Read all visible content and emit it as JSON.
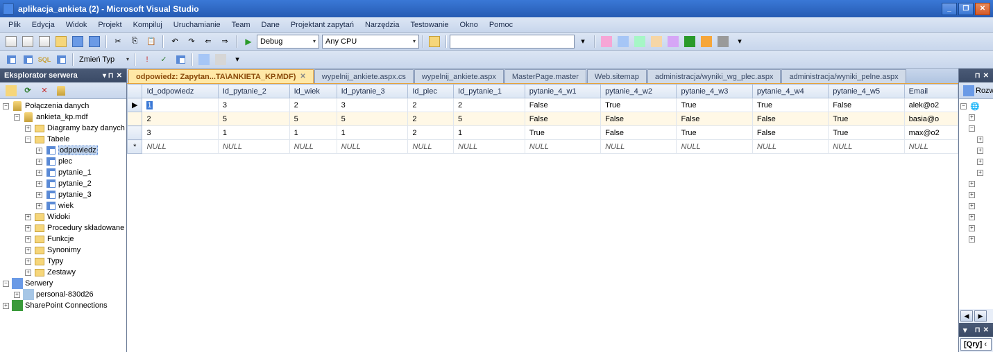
{
  "titlebar": {
    "title": "aplikacja_ankieta (2) - Microsoft Visual Studio"
  },
  "menu": [
    "Plik",
    "Edycja",
    "Widok",
    "Projekt",
    "Kompiluj",
    "Uruchamianie",
    "Team",
    "Dane",
    "Projektant zapytań",
    "Narzędzia",
    "Testowanie",
    "Okno",
    "Pomoc"
  ],
  "toolbar": {
    "config": "Debug",
    "platform": "Any CPU",
    "zmien": "Zmień Typ"
  },
  "explorer": {
    "title": "Eksplorator serwera",
    "tree": {
      "conn": "Połączenia danych",
      "db": "ankieta_kp.mdf",
      "diagrams": "Diagramy bazy danych",
      "tables": "Tabele",
      "tbl_odpowiedz": "odpowiedz",
      "tbl_plec": "plec",
      "tbl_pytanie1": "pytanie_1",
      "tbl_pytanie2": "pytanie_2",
      "tbl_pytanie3": "pytanie_3",
      "tbl_wiek": "wiek",
      "views": "Widoki",
      "procs": "Procedury składowane",
      "funcs": "Funkcje",
      "syns": "Synonimy",
      "types": "Typy",
      "assemblies": "Zestawy",
      "servers": "Serwery",
      "personal": "personal-830d26",
      "sharepoint": "SharePoint Connections"
    }
  },
  "tabs": [
    "odpowiedz: Zapytan...TA\\ANKIETA_KP.MDF)",
    "wypelnij_ankiete.aspx.cs",
    "wypelnij_ankiete.aspx",
    "MasterPage.master",
    "Web.sitemap",
    "administracja/wyniki_wg_plec.aspx",
    "administracja/wyniki_pelne.aspx"
  ],
  "grid": {
    "columns": [
      "Id_odpowiedz",
      "Id_pytanie_2",
      "Id_wiek",
      "Id_pytanie_3",
      "Id_plec",
      "Id_pytanie_1",
      "pytanie_4_w1",
      "pytanie_4_w2",
      "pytanie_4_w3",
      "pytanie_4_w4",
      "pytanie_4_w5",
      "Email"
    ],
    "rows": [
      [
        "1",
        "3",
        "2",
        "3",
        "2",
        "2",
        "False",
        "True",
        "True",
        "True",
        "False",
        "alek@o2"
      ],
      [
        "2",
        "5",
        "5",
        "5",
        "2",
        "5",
        "False",
        "False",
        "False",
        "False",
        "True",
        "basia@o"
      ],
      [
        "3",
        "1",
        "1",
        "1",
        "2",
        "1",
        "True",
        "False",
        "True",
        "False",
        "True",
        "max@o2"
      ]
    ],
    "null": "NULL"
  },
  "right": {
    "rozw": "Rozw"
  },
  "qry": "[Qry]"
}
